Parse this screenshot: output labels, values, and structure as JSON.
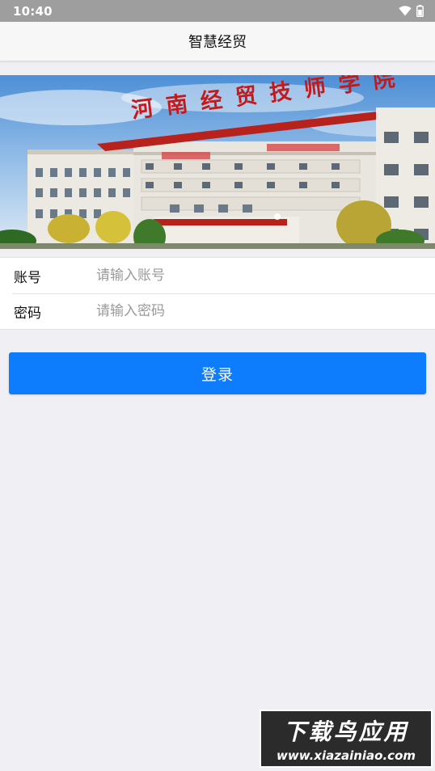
{
  "status_bar": {
    "time": "10:40"
  },
  "header": {
    "title": "智慧经贸"
  },
  "banner": {
    "sign_text": "河南经贸技师学院",
    "slides": 1
  },
  "login_form": {
    "account_label": "账号",
    "account_placeholder": "请输入账号",
    "password_label": "密码",
    "password_placeholder": "请输入密码",
    "submit_label": "登录"
  },
  "watermark": {
    "title": "下载鸟应用",
    "url": "www.xiazainiao.com"
  },
  "colors": {
    "primary": "#0d7dfd",
    "background": "#efeff4",
    "status_bar": "#9e9e9e",
    "sign_red": "#c21b1b"
  }
}
